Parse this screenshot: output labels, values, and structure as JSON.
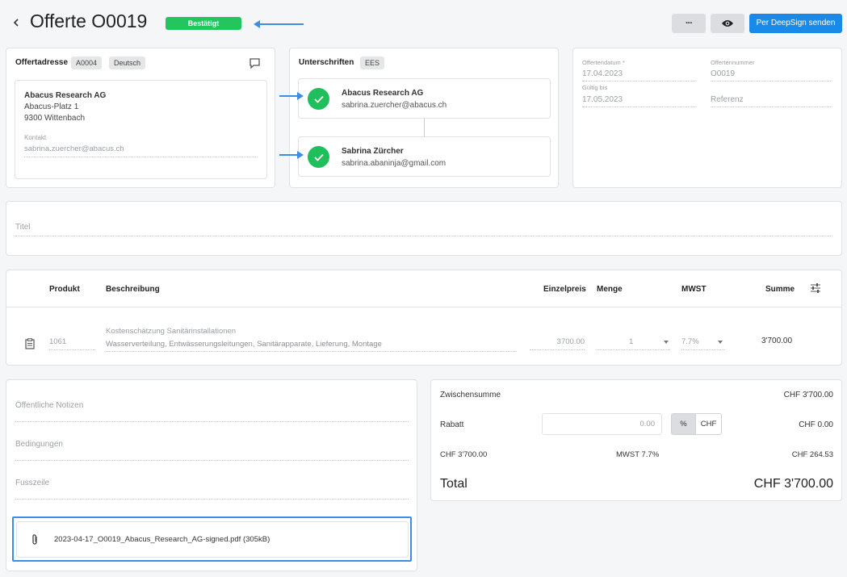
{
  "header": {
    "back_icon": "chevron-left-icon",
    "title": "Offerte O0019",
    "status": "Bestätigt",
    "status_color": "#23c55e",
    "more_label": "···",
    "preview_icon": "eye-icon",
    "send_label": "Per DeepSign senden",
    "accent": "#1a8ae8"
  },
  "address": {
    "heading": "Offertadresse",
    "chip_code": "A0004",
    "chip_lang": "Deutsch",
    "comment_icon": "comment-icon",
    "company": "Abacus Research AG",
    "street": "Abacus-Platz 1",
    "city": "9300 Wittenbach",
    "contact_label": "Kontakt",
    "contact_value": "sabrina.zuercher@abacus.ch"
  },
  "signatures": {
    "heading": "Unterschriften",
    "chip": "EES",
    "signers": [
      {
        "name": "Abacus Research AG",
        "email": "sabrina.zuercher@abacus.ch"
      },
      {
        "name": "Sabrina Zürcher",
        "email": "sabrina.abaninja@gmail.com"
      }
    ]
  },
  "meta": {
    "date_label": "Offertendatum *",
    "date_value": "17.04.2023",
    "number_label": "Offertennummer",
    "number_value": "O0019",
    "valid_label": "Gültig bis",
    "valid_value": "17.05.2023",
    "ref_placeholder": "Referenz"
  },
  "title_field": {
    "placeholder": "Titel"
  },
  "items": {
    "columns": {
      "product": "Produkt",
      "description": "Beschreibung",
      "unit_price": "Einzelpreis",
      "quantity": "Menge",
      "vat": "MWST",
      "sum": "Summe"
    },
    "settings_icon": "sliders-icon",
    "rows": [
      {
        "icon": "clipboard-icon",
        "product": "1061",
        "desc_title": "Kostenschätzung Sanitärinstallationen",
        "desc_detail": "Wasserverteilung, Entwässerungsleitungen, Sanitärapparate, Lieferung, Montage",
        "unit_price": "3700.00",
        "quantity": "1",
        "vat": "7.7%",
        "sum": "3'700.00"
      }
    ]
  },
  "notes": {
    "public_notes": "Öffentliche Notizen",
    "conditions": "Bedingungen",
    "footer": "Fusszeile",
    "attachment_icon": "paperclip-icon",
    "attachment": "2023-04-17_O0019_Abacus_Research_AG-signed.pdf (305kB)"
  },
  "totals": {
    "subtotal_label": "Zwischensumme",
    "subtotal_value": "CHF 3'700.00",
    "discount_label": "Rabatt",
    "discount_value": "0.00",
    "pct_label": "%",
    "chf_label": "CHF",
    "discount_total": "CHF 0.00",
    "vat_base": "CHF 3'700.00",
    "vat_label": "MWST 7.7%",
    "vat_value": "CHF 264.53",
    "total_label": "Total",
    "total_value": "CHF 3'700.00"
  }
}
